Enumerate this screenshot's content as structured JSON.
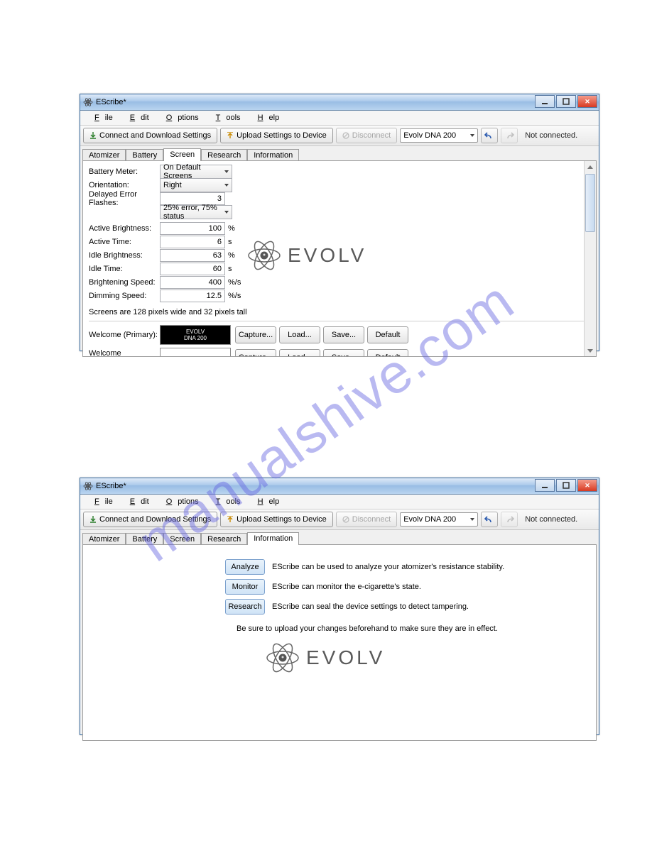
{
  "watermark": "manualshive.com",
  "window1": {
    "title": "EScribe*",
    "menu": {
      "file": "File",
      "edit": "Edit",
      "options": "Options",
      "tools": "Tools",
      "help": "Help"
    },
    "toolbar": {
      "connect_download": "Connect and Download Settings",
      "upload": "Upload Settings to Device",
      "disconnect": "Disconnect",
      "device_selected": "Evolv DNA 200",
      "status": "Not connected."
    },
    "tabs": {
      "atomizer": "Atomizer",
      "battery": "Battery",
      "screen": "Screen",
      "research": "Research",
      "information": "Information"
    },
    "screen_tab": {
      "battery_meter_label": "Battery Meter:",
      "battery_meter_value": "On Default Screens",
      "orientation_label": "Orientation:",
      "orientation_value": "Right",
      "delayed_error_label": "Delayed Error Flashes:",
      "delayed_error_value": "3",
      "error_status_value": "25% error, 75% status",
      "active_brightness_label": "Active Brightness:",
      "active_brightness_value": "100",
      "active_brightness_unit": "%",
      "active_time_label": "Active Time:",
      "active_time_value": "6",
      "active_time_unit": "s",
      "idle_brightness_label": "Idle Brightness:",
      "idle_brightness_value": "63",
      "idle_brightness_unit": "%",
      "idle_time_label": "Idle Time:",
      "idle_time_value": "60",
      "idle_time_unit": "s",
      "brightening_speed_label": "Brightening Speed:",
      "brightening_speed_value": "400",
      "brightening_speed_unit": "%/s",
      "dimming_speed_label": "Dimming Speed:",
      "dimming_speed_value": "12.5",
      "dimming_speed_unit": "%/s",
      "note": "Screens are 128 pixels wide and 32 pixels tall",
      "welcome_primary_label": "Welcome (Primary):",
      "welcome_primary_preview_l1": "EVOLV",
      "welcome_primary_preview_l2": "DNA  200",
      "welcome_secondary_label": "Welcome (Secondary):",
      "capture_btn": "Capture...",
      "load_btn": "Load...",
      "save_btn": "Save...",
      "default_btn": "Default",
      "logo_text": "EVOLV"
    }
  },
  "window2": {
    "title": "EScribe*",
    "menu": {
      "file": "File",
      "edit": "Edit",
      "options": "Options",
      "tools": "Tools",
      "help": "Help"
    },
    "toolbar": {
      "connect_download": "Connect and Download Settings",
      "upload": "Upload Settings to Device",
      "disconnect": "Disconnect",
      "device_selected": "Evolv DNA 200",
      "status": "Not connected."
    },
    "tabs": {
      "atomizer": "Atomizer",
      "battery": "Battery",
      "screen": "Screen",
      "research": "Research",
      "information": "Information"
    },
    "info_tab": {
      "analyze_btn": "Analyze",
      "analyze_text": "EScribe can be used to analyze your atomizer's resistance stability.",
      "monitor_btn": "Monitor",
      "monitor_text": "EScribe can monitor the e-cigarette's state.",
      "research_btn": "Research",
      "research_text": "EScribe can seal the device settings to detect tampering.",
      "upload_note": "Be sure to upload your changes beforehand to make sure they are in effect.",
      "logo_text": "EVOLV"
    }
  }
}
